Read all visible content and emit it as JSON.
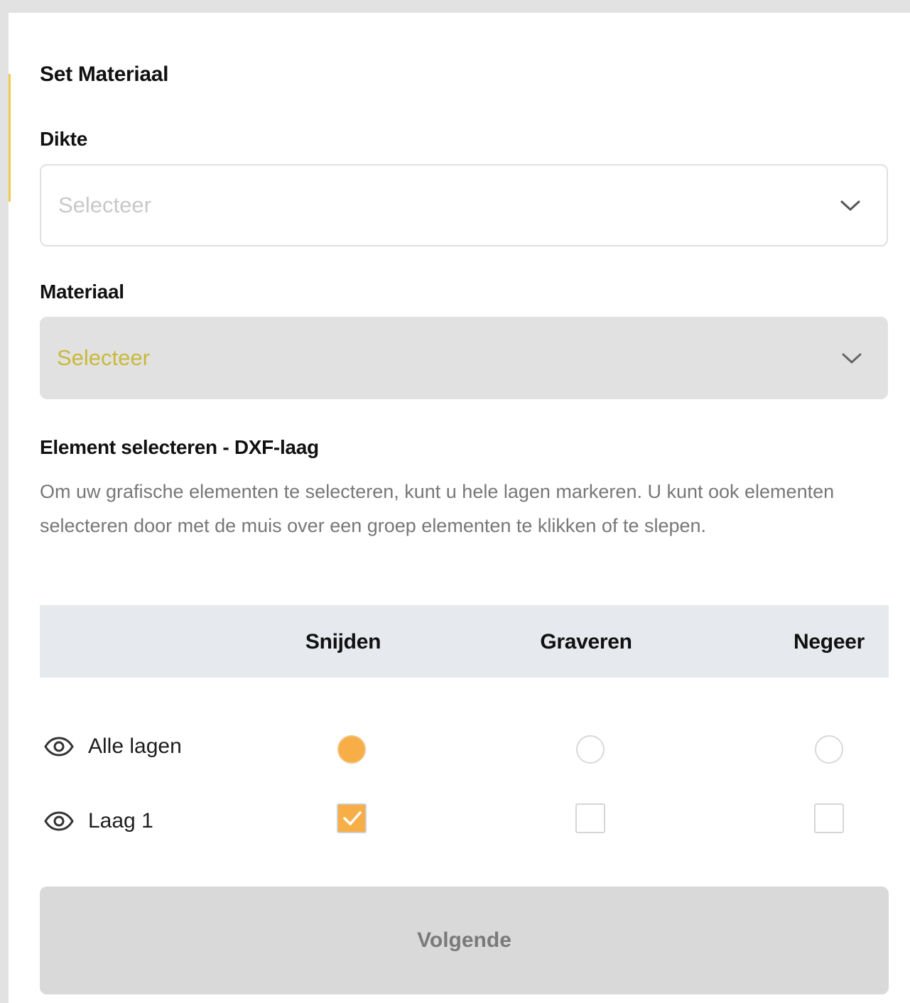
{
  "form": {
    "title": "Set Materiaal",
    "thickness": {
      "label": "Dikte",
      "placeholder": "Selecteer"
    },
    "material": {
      "label": "Materiaal",
      "placeholder": "Selecteer"
    }
  },
  "layers": {
    "heading": "Element selecteren - DXF-laag",
    "description": "Om uw grafische elementen te selecteren, kunt u hele lagen markeren. U kunt ook elementen selecteren door met de muis over een groep elementen te klikken of te slepen.",
    "columns": [
      "Snijden",
      "Graveren",
      "Negeer"
    ],
    "rows": [
      {
        "label": "Alle lagen",
        "control": "radio",
        "icon": "eye-icon",
        "selected": "Snijden"
      },
      {
        "label": "Laag 1",
        "control": "checkbox",
        "icon": "eye-icon",
        "checked": [
          "Snijden"
        ]
      }
    ]
  },
  "actions": {
    "next_label": "Volgende"
  },
  "colors": {
    "accent": "#f7ae47",
    "material_placeholder": "#c9b93b",
    "header_bg": "#e6e9ee"
  }
}
